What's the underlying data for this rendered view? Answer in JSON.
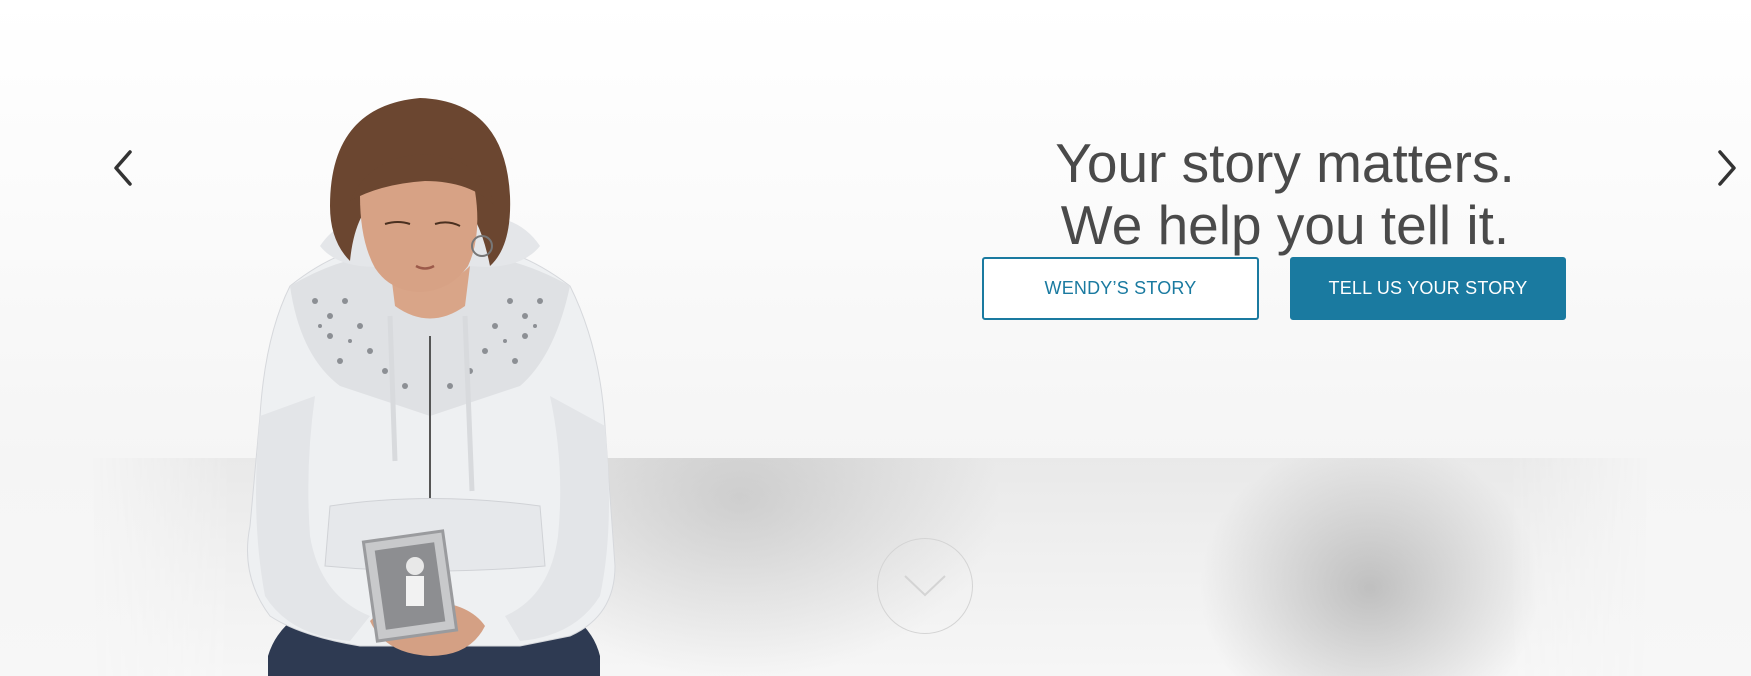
{
  "hero": {
    "headline_line1": "Your story matters.",
    "headline_line2": "We help you tell it.",
    "primary_button_label": "WENDY’S STORY",
    "secondary_button_label": "TELL US YOUR STORY"
  },
  "carousel": {
    "prev_icon": "chevron-left-icon",
    "next_icon": "chevron-right-icon",
    "scroll_icon": "chevron-down-icon"
  },
  "colors": {
    "accent": "#1a7aa0",
    "headline_text": "#4a4a4a",
    "arrow": "#333333",
    "background": "#f7f7f7"
  }
}
